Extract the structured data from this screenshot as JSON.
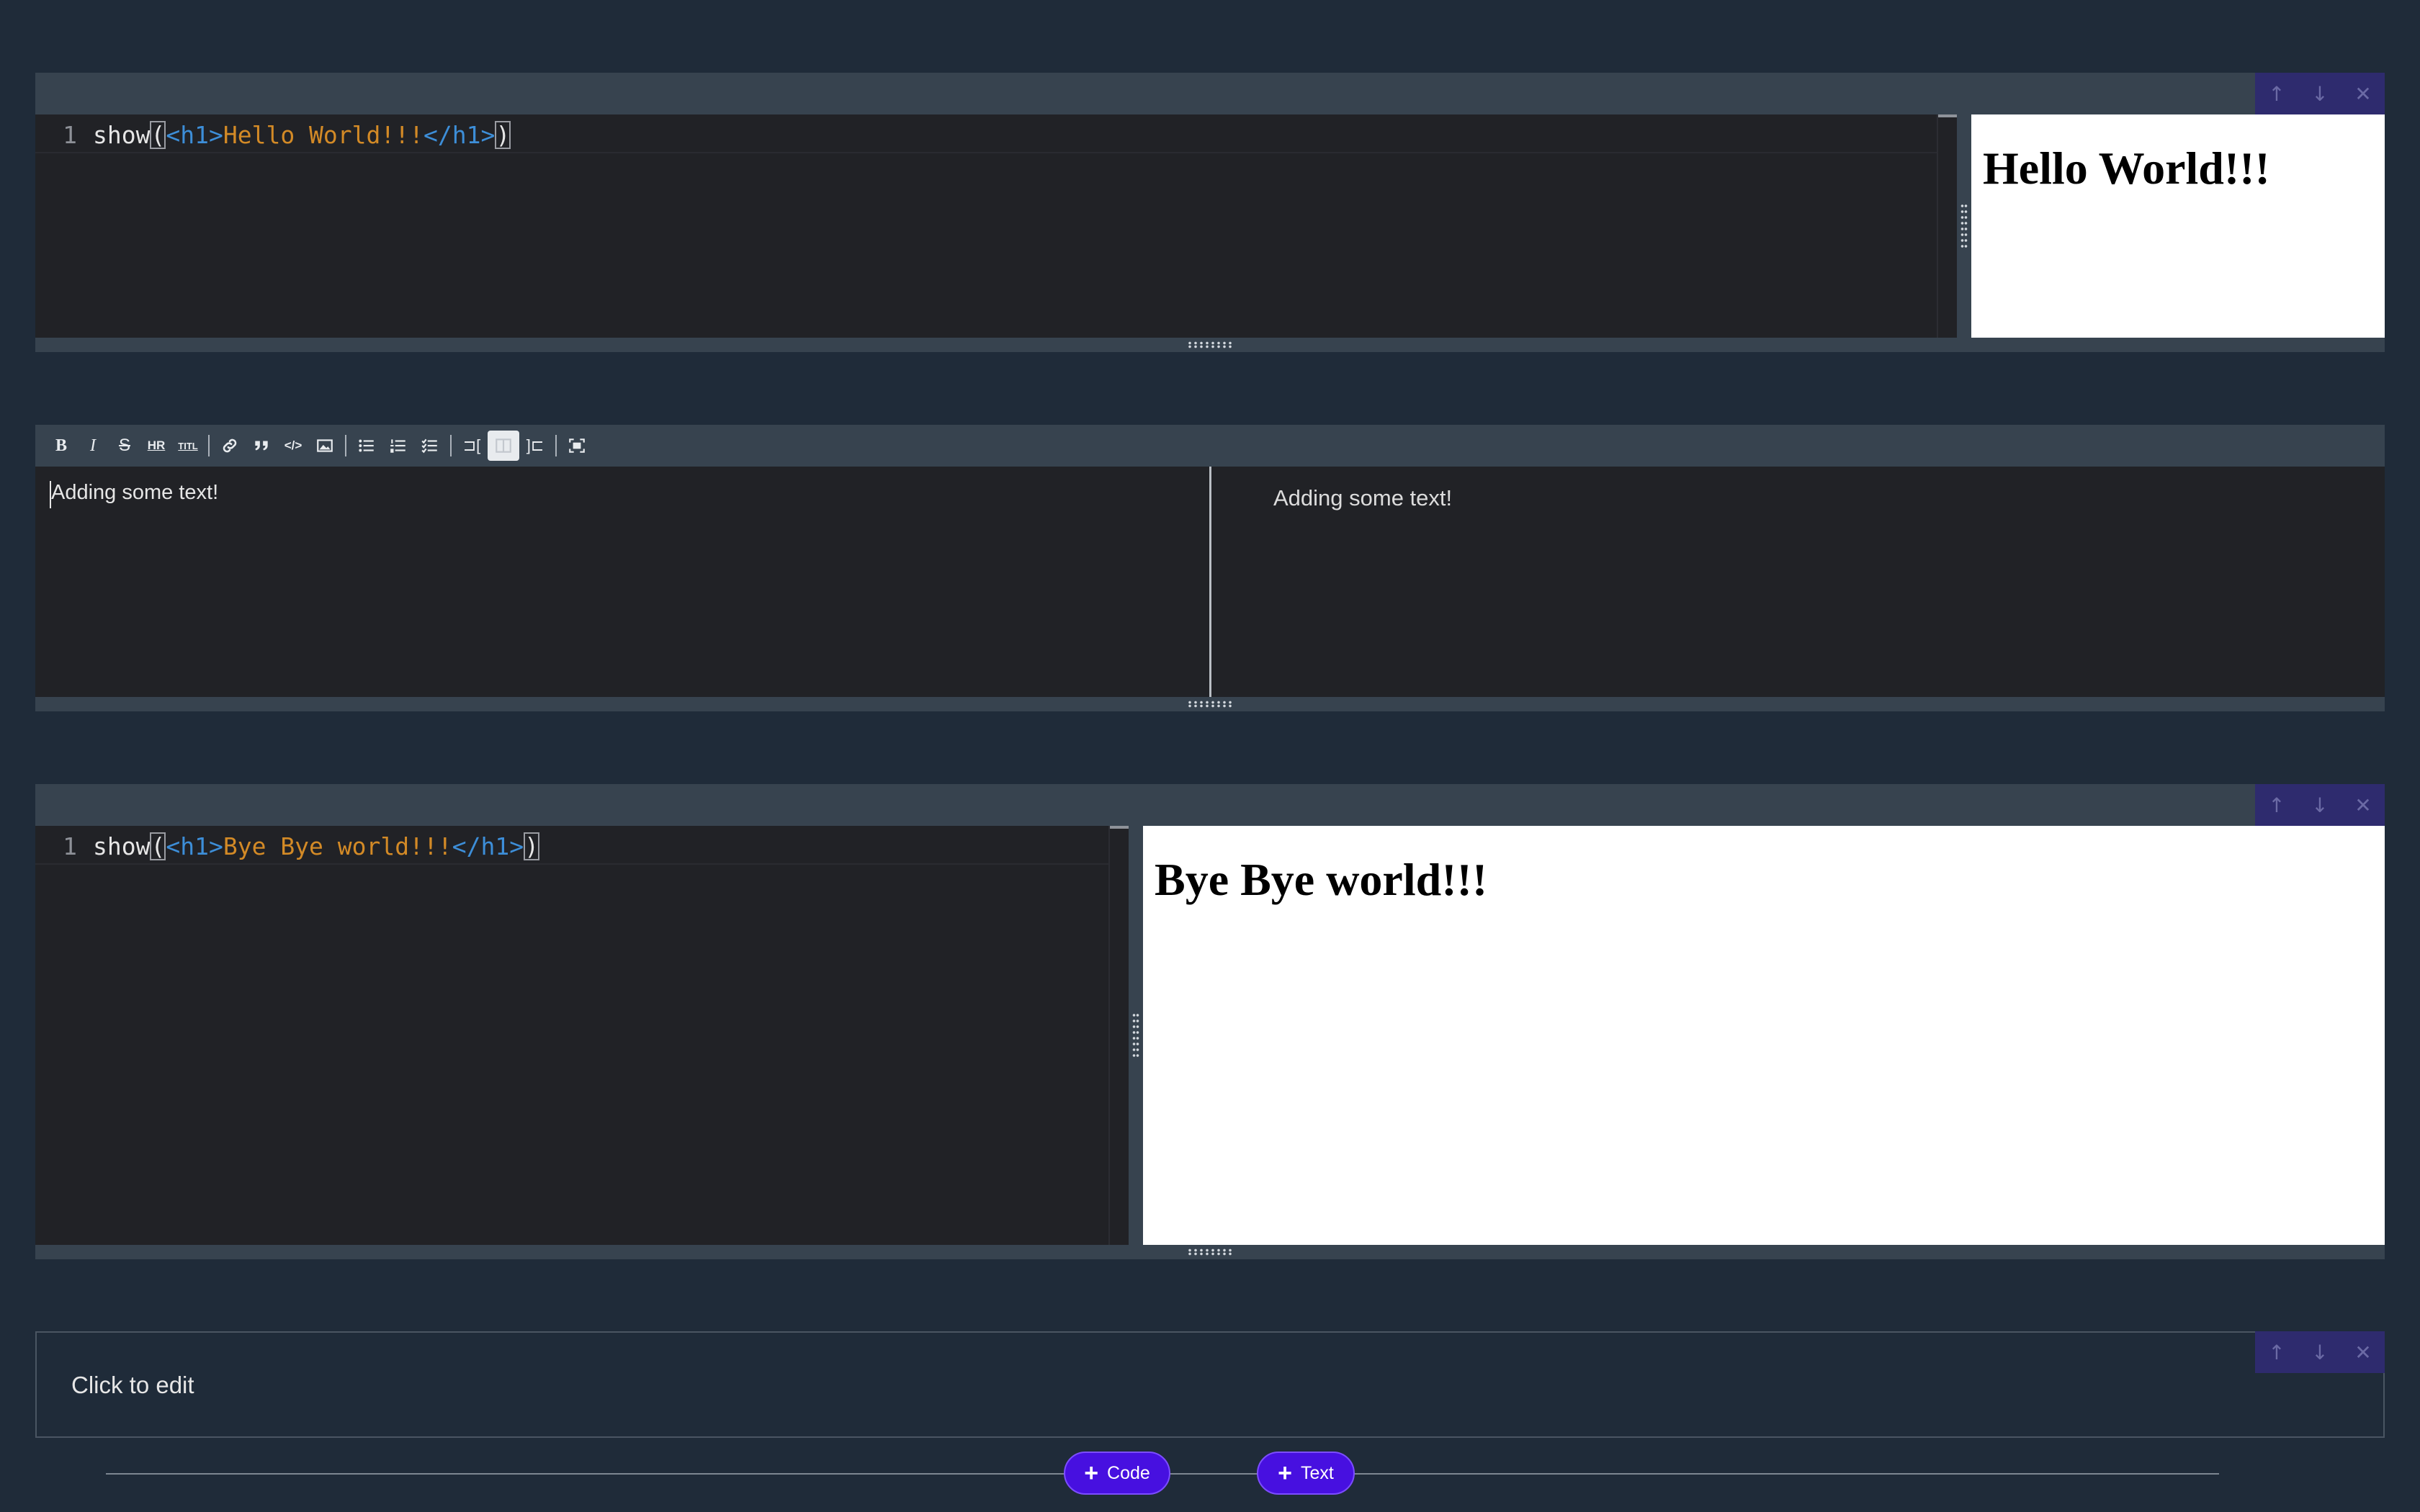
{
  "cells": [
    {
      "type": "code",
      "line_number": "1",
      "code": {
        "fn": "show",
        "open_paren": "(",
        "open_tag": "<h1>",
        "text": "Hello World!!!",
        "close_tag": "</h1>",
        "close_paren": ")"
      },
      "output_heading": "Hello World!!!"
    },
    {
      "type": "markdown",
      "source_text": "Adding some text!",
      "preview_text": "Adding some text!"
    },
    {
      "type": "code",
      "line_number": "1",
      "code": {
        "fn": "show",
        "open_paren": "(",
        "open_tag": "<h1>",
        "text": "Bye Bye world!!!",
        "close_tag": "</h1>",
        "close_paren": ")"
      },
      "output_heading": "Bye Bye world!!!"
    },
    {
      "type": "text",
      "placeholder": "Click to edit"
    }
  ],
  "cell_controls": {
    "move_up": "↑",
    "move_down": "↓",
    "delete": "✕"
  },
  "toolbar": {
    "bold": "B",
    "italic": "I",
    "strikethrough": "S",
    "hr": "HR",
    "title": "TITL",
    "link": "🔗",
    "quote": "❞",
    "code": "</>",
    "image": "▨",
    "ul": "☰",
    "ol": "☷",
    "checklist": "☑",
    "edit_only": "⊐[",
    "split": "⊞",
    "preview_only": "]⊏",
    "fullscreen": "⛶"
  },
  "add_buttons": {
    "code": "Code",
    "text": "Text",
    "plus": "+"
  },
  "colors": {
    "background": "#1f2b39",
    "editor": "#212226",
    "header": "#37434f",
    "accent": "#4710e0",
    "tag": "#3d8ed8",
    "string": "#d38a26"
  }
}
